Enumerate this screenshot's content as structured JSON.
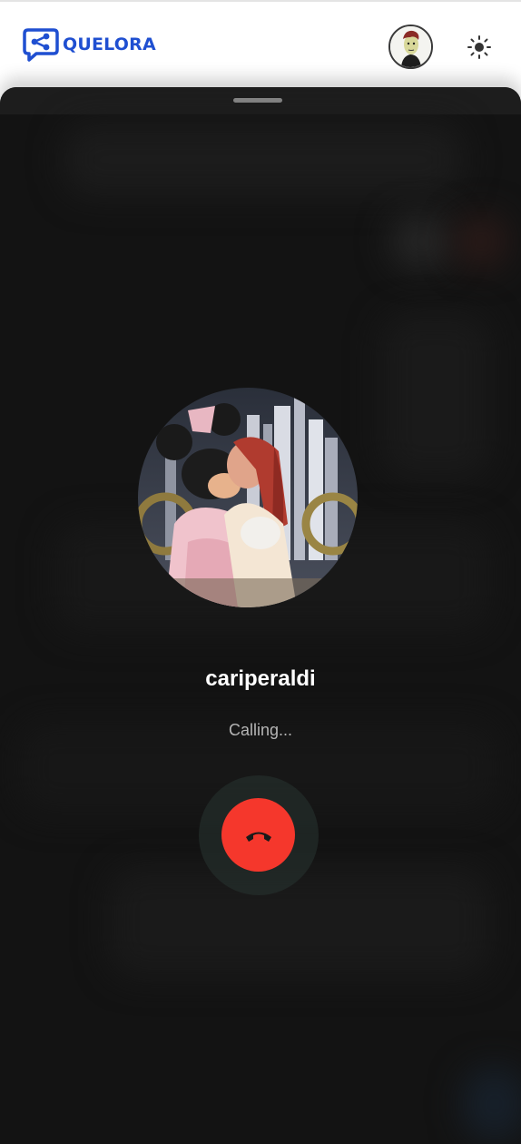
{
  "header": {
    "brand_name": "QUELORA",
    "brand_color": "#1f4fd1",
    "logo_icon": "share-chat-icon",
    "avatar_icon": "user-avatar",
    "theme_toggle_icon": "sun-icon"
  },
  "call": {
    "caller_name": "cariperaldi",
    "status": "Calling...",
    "hangup_icon": "phone-hangup-icon",
    "hangup_color": "#f5372c",
    "background_color": "#131313"
  }
}
